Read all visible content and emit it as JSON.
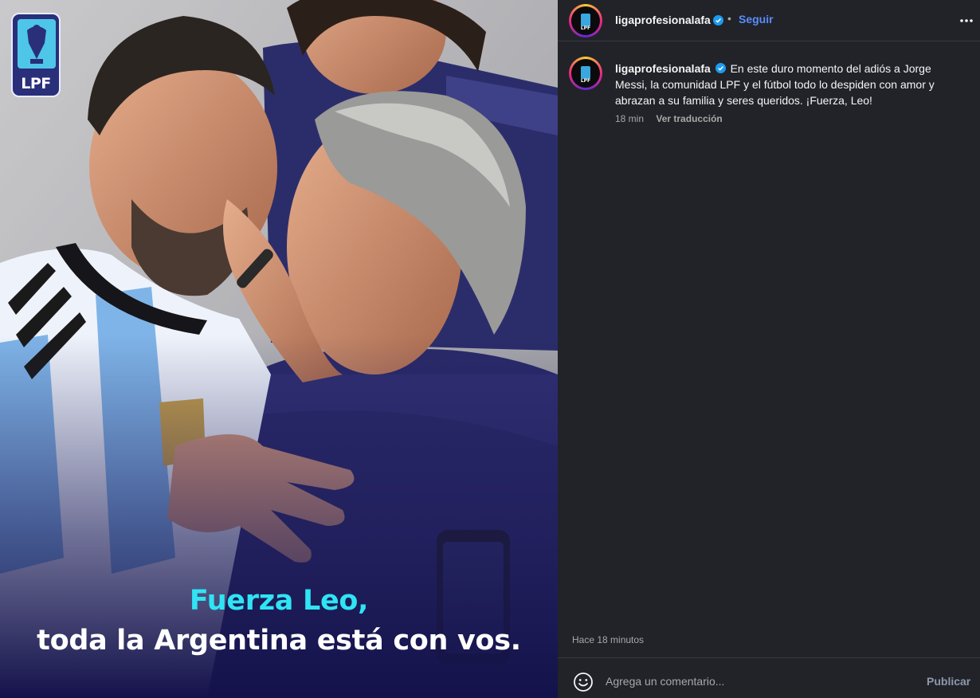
{
  "post": {
    "logo_text": "LPF",
    "caption_line1": "Fuerza Leo,",
    "caption_line2": "toda la Argentina está con vos."
  },
  "header": {
    "username": "ligaprofesionalafa",
    "separator": "•",
    "follow_label": "Seguir",
    "more_icon": "more-horizontal-icon"
  },
  "comment": {
    "username": "ligaprofesionalafa",
    "text": "En este duro momento del adiós a Jorge Messi, la comunidad LPF y el fútbol todo lo despiden con amor y abrazan a su familia y seres queridos. ¡Fuerza, Leo!",
    "time": "18 min",
    "translate_label": "Ver traducción"
  },
  "footer": {
    "time_ago": "Hace 18 minutos",
    "input_placeholder": "Agrega un comentario...",
    "publish_label": "Publicar",
    "emoji_icon": "emoji-smile-icon"
  },
  "colors": {
    "background": "#212328",
    "accent_blue": "#5b8cff",
    "caption_cyan": "#2fe4f4",
    "verified_blue": "#1d9bf0"
  }
}
